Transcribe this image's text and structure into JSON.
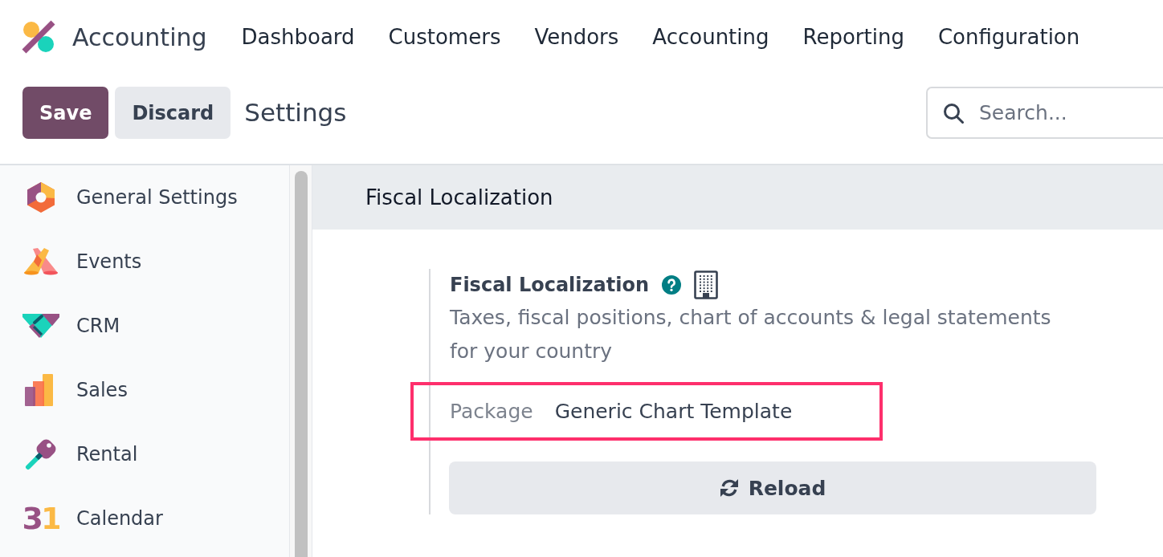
{
  "app": {
    "name": "Accounting"
  },
  "menu": [
    {
      "label": "Dashboard"
    },
    {
      "label": "Customers"
    },
    {
      "label": "Vendors"
    },
    {
      "label": "Accounting"
    },
    {
      "label": "Reporting"
    },
    {
      "label": "Configuration"
    }
  ],
  "control_panel": {
    "buttons": [
      {
        "label": "Save",
        "kind": "primary"
      },
      {
        "label": "Discard",
        "kind": "secondary"
      }
    ],
    "title": "Settings",
    "search": {
      "placeholder": "Search..."
    }
  },
  "sidebar": {
    "items": [
      {
        "label": "General Settings",
        "selected": false
      },
      {
        "label": "Events",
        "selected": false
      },
      {
        "label": "CRM",
        "selected": false
      },
      {
        "label": "Sales",
        "selected": false
      },
      {
        "label": "Rental",
        "selected": false
      },
      {
        "label": "Calendar",
        "selected": false,
        "icon_text": "31"
      }
    ]
  },
  "section": {
    "title": "Fiscal Localization",
    "setting": {
      "title": "Fiscal Localization",
      "description": "Taxes, fiscal positions, chart of accounts & legal statements for your country",
      "field": {
        "label": "Package",
        "value": "Generic Chart Template",
        "highlighted": true
      },
      "button": {
        "label": "Reload"
      }
    }
  }
}
